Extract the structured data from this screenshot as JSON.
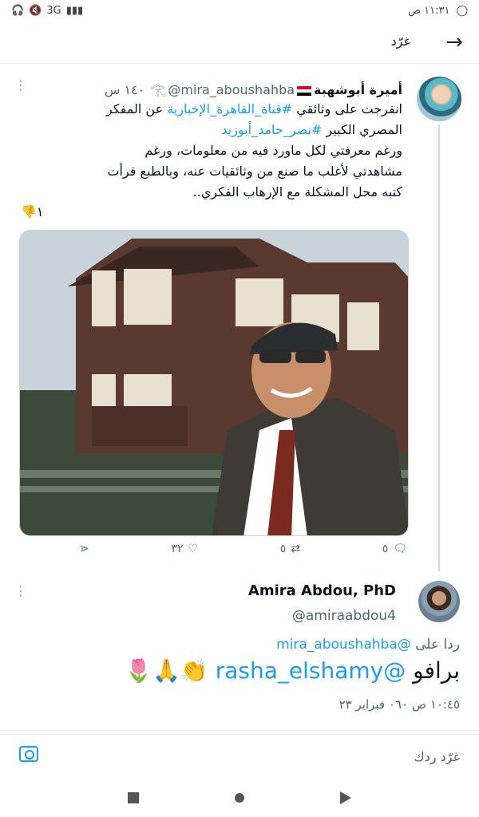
{
  "status_bar": {
    "time": "١١:٣١ ص",
    "network": "3G",
    "icons": [
      "whatsapp-icon",
      "signal-icon",
      "mute-icon",
      "headset-icon"
    ]
  },
  "header": {
    "title": "غرّد",
    "back_icon": "arrow-icon"
  },
  "tweet": {
    "author_name": "أميرة أبوشهبة",
    "author_handle": "@mira_aboushahba",
    "time": "١٤٠ س",
    "text_line1_prefix": "انفرجت على وثائقي ",
    "hashtag1": "#قناة_القاهرة_الإخبارية",
    "text_line1_suffix": " عن المفكر المصري الكبير ",
    "hashtag2": "#نصر_حامد_أبوزيد",
    "text_body": "ورغم معرفتي لكل ماورد فيه من معلومات، ورغم مشاهدتي لأغلب ما صنع من وثائقيات عنه، وبالطبع قرأت كتبه محل المشكلة مع الإرهاب الفكري..",
    "reaction_count": "١",
    "reaction_emoji": "👎",
    "actions": {
      "replies": "٥",
      "retweets": "٥",
      "likes": "٣٢"
    }
  },
  "reply": {
    "author_name": "Amira Abdou, PhD",
    "author_handle": "@amiraabdou4",
    "replying_label": "ردا على",
    "replying_to": "@mira_aboushahba",
    "mention": "@rasha_elshamy",
    "message": "برافو",
    "emojis": "👏🙏🌷",
    "timestamp": "١٠:٤٥ ص ٠٦٠ فبراير ٢٣"
  },
  "reply_bar": {
    "placeholder": "غرّد ردك"
  },
  "colors": {
    "accent": "#1d9bf0",
    "text": "#0f1419",
    "muted": "#536471"
  }
}
